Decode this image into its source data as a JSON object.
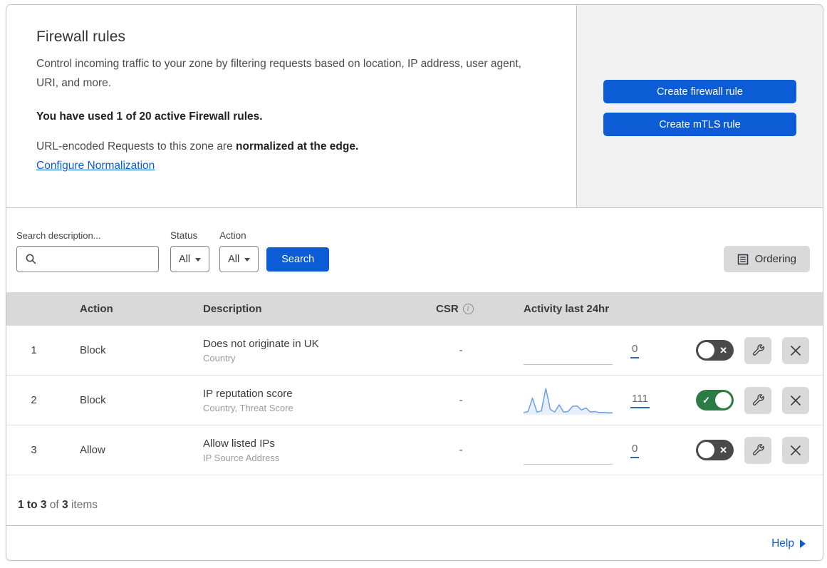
{
  "header": {
    "title": "Firewall rules",
    "description": "Control incoming traffic to your zone by filtering requests based on location, IP address, user agent, URI, and more.",
    "usage": "You have used 1 of 20 active Firewall rules.",
    "normalization_prefix": "URL-encoded Requests to this zone are ",
    "normalization_bold": "normalized at the edge.",
    "normalization_link": "Configure Normalization",
    "create_firewall_button": "Create firewall rule",
    "create_mtls_button": "Create mTLS rule"
  },
  "filters": {
    "search_label": "Search description...",
    "search_value": "",
    "status_label": "Status",
    "status_value": "All",
    "action_label": "Action",
    "action_value": "All",
    "search_button": "Search",
    "ordering_button": "Ordering"
  },
  "table": {
    "columns": {
      "action": "Action",
      "description": "Description",
      "csr": "CSR",
      "csr_info_icon": "i",
      "activity": "Activity last 24hr"
    },
    "rows": [
      {
        "num": "1",
        "action": "Block",
        "description": "Does not originate in UK",
        "fields": "Country",
        "csr": "-",
        "count": "0",
        "enabled": false,
        "sparkline": null
      },
      {
        "num": "2",
        "action": "Block",
        "description": "IP reputation score",
        "fields": "Country, Threat Score",
        "csr": "-",
        "count": "111",
        "enabled": true,
        "sparkline": [
          5,
          10,
          62,
          8,
          12,
          100,
          18,
          8,
          36,
          8,
          10,
          30,
          32,
          16,
          24,
          8,
          10,
          6,
          6,
          5,
          5
        ]
      },
      {
        "num": "3",
        "action": "Allow",
        "description": "Allow listed IPs",
        "fields": "IP Source Address",
        "csr": "-",
        "count": "0",
        "enabled": false,
        "sparkline": null
      }
    ]
  },
  "footer": {
    "items_range": "1 to 3",
    "items_of": " of ",
    "items_total": "3",
    "items_suffix": " items",
    "help_label": "Help"
  },
  "glyphs": {
    "toggle_on": "✓",
    "toggle_off": "✕"
  },
  "colors": {
    "accent": "#0b5cd5",
    "toggle_on": "#2b7c44",
    "toggle_off": "#494949",
    "sparkline": "#6d9ee8",
    "table_header": "#d9d9d9",
    "gray_panel": "#f1f1f2",
    "gray_button": "#d9d9d9"
  }
}
